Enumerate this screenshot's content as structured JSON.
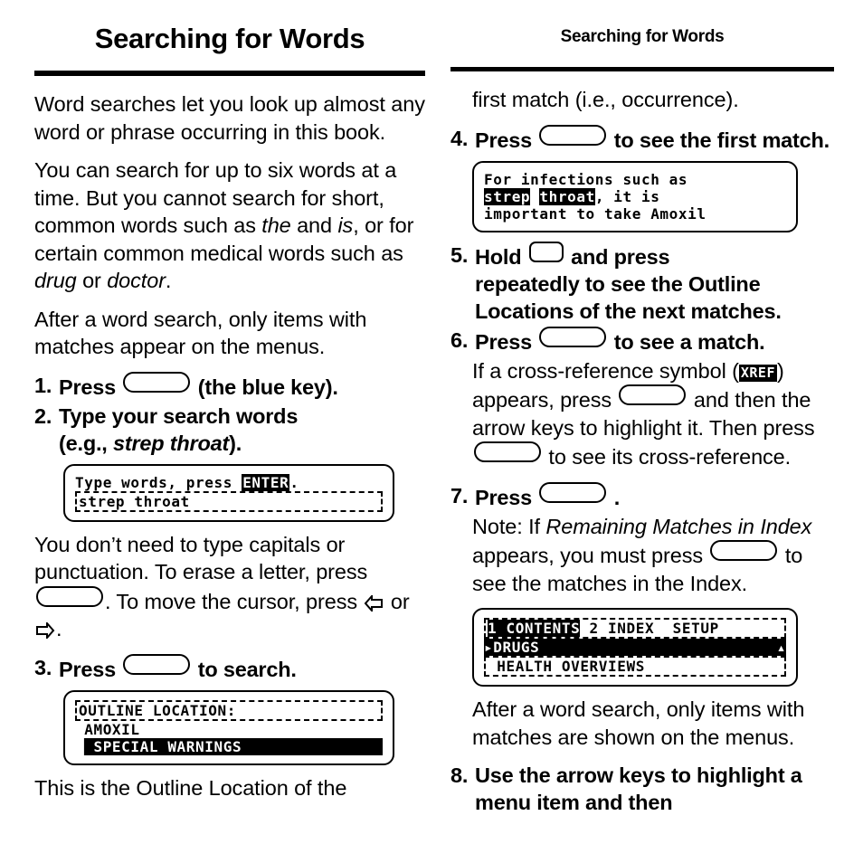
{
  "left": {
    "title": "Searching for Words",
    "paragraphs": [
      "Word searches let you look up almost any word or phrase occurring in this book.",
      "You can search for up to six words at a time. But you cannot search for short, common words such as ",
      "After a word search, only items with matches appear on the menus."
    ],
    "p2_italic_1": "the",
    "p2_mid": " and ",
    "p2_italic_2": "is",
    "p2_mid2": ", or for certain common medical words such as ",
    "p2_italic_3": "drug",
    "p2_mid3": " or ",
    "p2_italic_4": "doctor",
    "p2_end": ".",
    "steps": [
      {
        "num": "1.",
        "pre": "Press",
        "post": "(the blue key)."
      },
      {
        "num": "2.",
        "pre": "Type your search words",
        "line2_pre": "(e.g., ",
        "line2_italic": "strep throat",
        "line2_post": ")."
      },
      {
        "num": "3.",
        "pre": "Press",
        "post": "to search."
      }
    ],
    "screen1": {
      "line1_a": "Type words, press ",
      "line1_badge": "ENTER",
      "line1_b": ".",
      "line2": "strep throat"
    },
    "after_screen1": {
      "a": "You don’t need to type capitals or punctuation. To erase a letter, press ",
      "b": ". To move the cursor, press ",
      "c": " or ",
      "d": "."
    },
    "screen2": {
      "line1": "OUTLINE LOCATION:",
      "line2": " AMOXIL",
      "line3_mark": "█",
      "line3": " SPECIAL WARNINGS"
    },
    "closing": "This is the Outline Location of the"
  },
  "right": {
    "title": "Searching for Words",
    "intro": "first match (i.e., occurrence).",
    "steps": [
      {
        "num": "4.",
        "pre": "Press",
        "post": "to see the first match."
      },
      {
        "num": "5.",
        "pre": "Hold",
        "mid": "and press",
        "post": "repeatedly to see the Outline Locations of the next matches."
      },
      {
        "num": "6.",
        "pre": "Press",
        "post": "to see a match."
      },
      {
        "num": "7.",
        "pre": "Press",
        "post": "."
      },
      {
        "num": "8.",
        "pre": "Use the arrow keys to highlight a menu item and then"
      }
    ],
    "screen1": {
      "line1": "For infections such as",
      "line2_a": "strep",
      "line2_sp": " ",
      "line2_b": "throat",
      "line2_c": ", it is",
      "line3": "important to take Amoxil"
    },
    "xref_para": {
      "a": "If a cross-reference symbol (",
      "badge": "XREF",
      "b": ") appears, press ",
      "c": " and then the arrow keys to highlight it. Then press ",
      "d": " to see its cross-reference."
    },
    "note": {
      "a": "Note: If ",
      "italic": "Remaining Matches in Index",
      "b": " appears, you must press ",
      "c": " to see the matches in the Index."
    },
    "screen2": {
      "line1_a": "1 CONTENTS",
      "line1_b": " 2 INDEX  SETUP",
      "line2": "▸DRUGS",
      "line2_end": "▴",
      "line3": " HEALTH OVERVIEWS"
    },
    "closing": "After a word search, only items with matches are shown on the menus."
  }
}
